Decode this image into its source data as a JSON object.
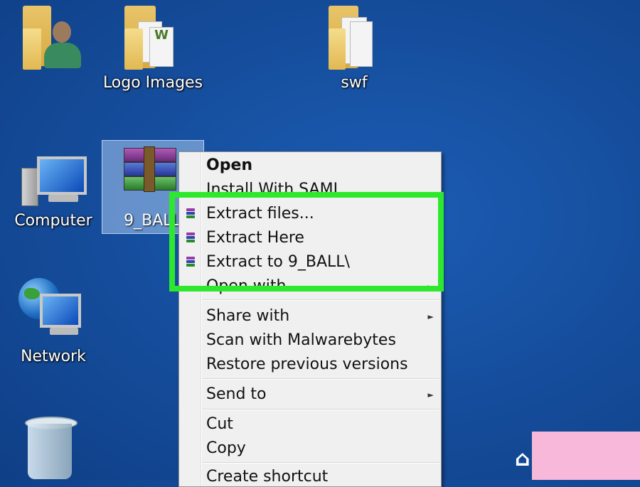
{
  "desktop": {
    "icons": [
      {
        "label": "",
        "kind": "user-folder"
      },
      {
        "label": "Logo Images",
        "kind": "folder"
      },
      {
        "label": "swf",
        "kind": "folder"
      },
      {
        "label": "Computer",
        "kind": "computer"
      },
      {
        "label": "9_BALL",
        "kind": "rar-archive"
      },
      {
        "label": "Network",
        "kind": "network"
      },
      {
        "label": "",
        "kind": "recycle-bin"
      }
    ]
  },
  "context_menu": {
    "items": [
      {
        "label": "Open",
        "bold": true
      },
      {
        "label": "Install With SAMI"
      },
      {
        "label": "Extract files...",
        "icon": "winrar-icon"
      },
      {
        "label": "Extract Here",
        "icon": "winrar-icon"
      },
      {
        "label": "Extract to 9_BALL\\",
        "icon": "winrar-icon"
      },
      {
        "label": "Open with",
        "submenu": true
      },
      {
        "label": "Share with",
        "submenu": true
      },
      {
        "label": "Scan with Malwarebytes"
      },
      {
        "label": "Restore previous versions"
      },
      {
        "label": "Send to",
        "submenu": true
      },
      {
        "label": "Cut"
      },
      {
        "label": "Copy"
      },
      {
        "label": "Create shortcut"
      }
    ]
  },
  "colors": {
    "desktop_bg": "#164f9f",
    "highlight": "#2ee82e",
    "menu_bg": "#f0f0f0",
    "corner_badge": "#f7b8d9"
  }
}
